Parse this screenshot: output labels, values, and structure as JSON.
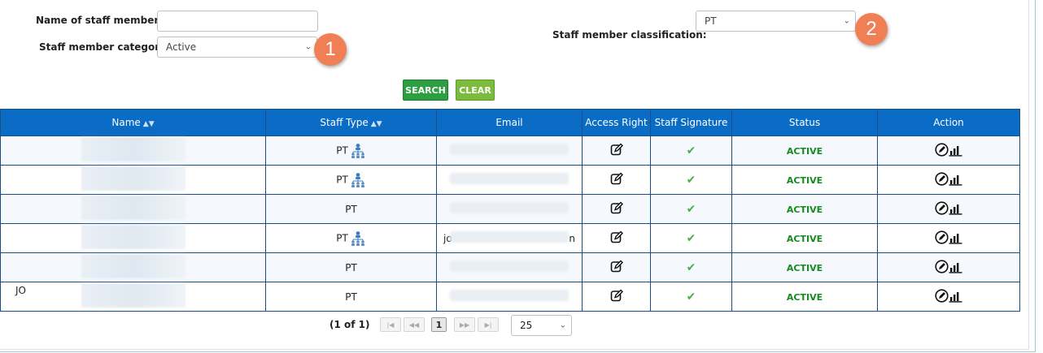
{
  "filters": {
    "name_label": "Name of staff member:",
    "name_value": "",
    "category_label": "Staff member category",
    "category_value": "Active",
    "classification_label": "Staff member classification:",
    "classification_value": "PT"
  },
  "callouts": {
    "one": "1",
    "two": "2"
  },
  "buttons": {
    "search": "SEARCH",
    "clear": "CLEAR"
  },
  "table": {
    "headers": [
      "Name",
      "Staff Type",
      "Email",
      "Access Right",
      "Staff Signature",
      "Status",
      "Action"
    ],
    "rows": [
      {
        "staff_type": "PT",
        "email_partial": "",
        "status": "ACTIVE"
      },
      {
        "staff_type": "PT",
        "email_partial": "",
        "status": "ACTIVE"
      },
      {
        "staff_type": "PT",
        "email_partial": "",
        "status": "ACTIVE"
      },
      {
        "staff_type": "PT",
        "email_partial": "jo",
        "status": "ACTIVE",
        "email_suffix": "n"
      },
      {
        "staff_type": "PT",
        "email_partial": "",
        "status": "ACTIVE"
      },
      {
        "staff_type": "PT",
        "name_partial": "JO",
        "email_partial": "",
        "status": "ACTIVE"
      }
    ]
  },
  "pager": {
    "info": "(1 of 1)",
    "current_page": "1",
    "page_size": "25"
  },
  "colors": {
    "header_bg": "#0a6cc4",
    "active": "#168a20",
    "search_btn": "#2e9e42",
    "clear_btn": "#7dbb3f",
    "callout": "#f07f55"
  },
  "icons": {
    "sort": "sort-icon",
    "team": "team-hierarchy-icon",
    "edit": "edit-icon",
    "check": "check-icon",
    "pencil": "pencil-circle-icon",
    "report": "bar-chart-icon"
  }
}
